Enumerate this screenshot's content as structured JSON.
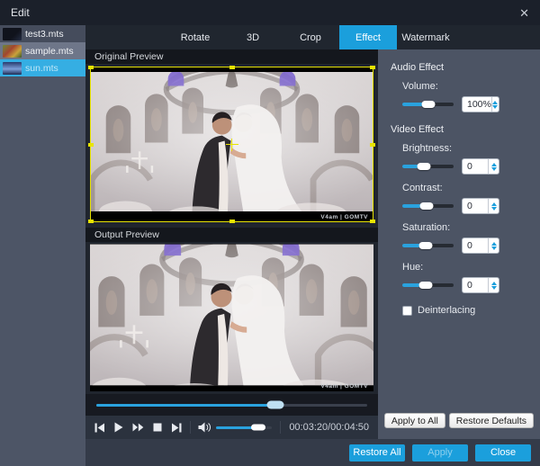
{
  "window": {
    "title": "Edit",
    "close_icon": "✕"
  },
  "sidebar": {
    "files": [
      {
        "name": "test3.mts"
      },
      {
        "name": "sample.mts"
      },
      {
        "name": "sun.mts"
      }
    ]
  },
  "tabs": {
    "items": [
      {
        "label": "Rotate"
      },
      {
        "label": "3D"
      },
      {
        "label": "Crop"
      },
      {
        "label": "Effect"
      },
      {
        "label": "Watermark"
      }
    ],
    "active": "Effect"
  },
  "preview": {
    "original_label": "Original Preview",
    "output_label": "Output Preview",
    "watermark": "V4am | GOMTV"
  },
  "transport": {
    "time": "00:03:20/00:04:50",
    "seek_pct": 66,
    "volume_pct": 75
  },
  "effects": {
    "audio_header": "Audio Effect",
    "volume": {
      "label": "Volume:",
      "value": "100%",
      "pct": 50
    },
    "video_header": "Video Effect",
    "brightness": {
      "label": "Brightness:",
      "value": "0",
      "pct": 42
    },
    "contrast": {
      "label": "Contrast:",
      "value": "0",
      "pct": 48
    },
    "saturation": {
      "label": "Saturation:",
      "value": "0",
      "pct": 45
    },
    "hue": {
      "label": "Hue:",
      "value": "0",
      "pct": 45
    },
    "deinterlacing_label": "Deinterlacing"
  },
  "buttons": {
    "apply_to_all": "Apply to All",
    "restore_defaults": "Restore Defaults",
    "restore_all": "Restore All",
    "apply": "Apply",
    "close": "Close"
  },
  "colors": {
    "accent_blue": "#1b9fdc",
    "selection_blue": "#35aee3",
    "panel_gray": "#4c5464",
    "crop_yellow": "#e8e400"
  }
}
